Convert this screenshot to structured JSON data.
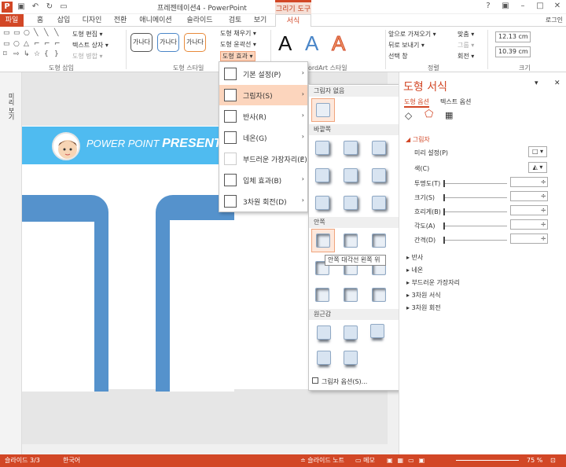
{
  "title_bar": {
    "title": "프레젠테이션4 - PowerPoint",
    "context_tab": "그리기 도구",
    "login": "로그인"
  },
  "tabs": [
    "파일",
    "홈",
    "삽입",
    "디자인",
    "전환",
    "애니메이션",
    "슬라이드 쇼",
    "검토",
    "보기",
    "서식"
  ],
  "ribbon": {
    "edit_shape": "도형 편집 ▾",
    "text_box": "텍스트 상자 ▾",
    "merge_shapes": "도형 병합 ▾",
    "group_insert": "도형 삽입",
    "group_styles": "도형 스타일",
    "group_wordart": "ordArt 스타일",
    "group_arrange": "정렬",
    "group_size": "크기",
    "style_sample": "가나다",
    "fill": "도형 채우기 ▾",
    "outline": "도형 윤곽선 ▾",
    "effects": "도형 효과 ▾",
    "bring_forward": "앞으로 가져오기 ▾",
    "send_backward": "뒤로 보내기 ▾",
    "selection_pane": "선택 창",
    "align": "맞춤 ▾",
    "group": "그룹 ▾",
    "rotate": "회전 ▾",
    "height": "12.13 cm",
    "width": "10.39 cm",
    "wordart_letter": "A"
  },
  "left_panel_label": "미리 보기",
  "slide": {
    "banner_text_a": "POWER POINT ",
    "banner_text_b": "PRESENTA"
  },
  "effects_menu": [
    {
      "label": "기본 설정(P)"
    },
    {
      "label": "그림자(S)"
    },
    {
      "label": "반사(R)"
    },
    {
      "label": "네온(G)"
    },
    {
      "label": "부드러운 가장자리(E)"
    },
    {
      "label": "입체 효과(B)"
    },
    {
      "label": "3차원 회전(D)"
    }
  ],
  "shadow_gallery": {
    "none": "그림자 없음",
    "outer": "바깥쪽",
    "inner": "안쪽",
    "perspective": "원근감",
    "options": "그림자 옵션(S)...",
    "tooltip": "안쪽 대각선 왼쪽 위"
  },
  "format_pane": {
    "title": "도형 서식",
    "tab_shape": "도형 옵션",
    "tab_text": "텍스트 옵션",
    "section": "그림자",
    "rows": [
      "미리 설정(P)",
      "색(C)",
      "투명도(T)",
      "크기(S)",
      "흐리게(B)",
      "각도(A)",
      "간격(D)"
    ],
    "collapsed": [
      "반사",
      "네온",
      "부드러운 가장자리",
      "3차원 서식",
      "3차원 회전"
    ]
  },
  "status": {
    "slide": "슬라이드 3/3",
    "lang": "한국어",
    "notes": "슬라이드 노트",
    "memo": "메모",
    "zoom": "75 %"
  },
  "colors": {
    "accent": "#d24726",
    "banner": "#4fbbf0",
    "frame": "#5592cc"
  }
}
